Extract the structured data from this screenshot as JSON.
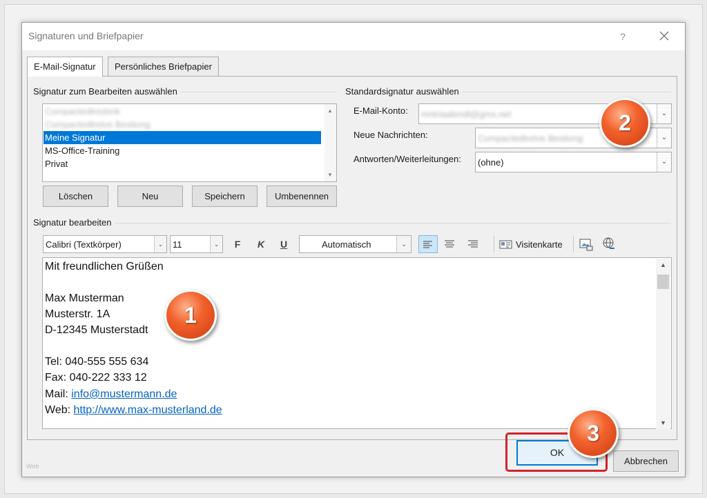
{
  "dialog": {
    "title": "Signaturen und Briefpapier",
    "help_label": "?"
  },
  "tabs": [
    {
      "label": "E-Mail-Signatur",
      "active": true
    },
    {
      "label": "Persönliches Briefpapier",
      "active": false
    }
  ],
  "signature_select": {
    "group_label": "Signatur zum Bearbeiten auswählen",
    "items": [
      {
        "label": "Compactedtredsrik",
        "blurred": true,
        "selected": false
      },
      {
        "label": "Compactedtrelve Bestiong",
        "blurred": true,
        "selected": false
      },
      {
        "label": "Meine Signatur",
        "blurred": false,
        "selected": true
      },
      {
        "label": "MS-Office-Training",
        "blurred": false,
        "selected": false
      },
      {
        "label": "Privat",
        "blurred": false,
        "selected": false
      }
    ],
    "buttons": {
      "delete": "Löschen",
      "new": "Neu",
      "save": "Speichern",
      "rename": "Umbenennen"
    }
  },
  "default_signature": {
    "group_label": "Standardsignatur auswählen",
    "email_account_label": "E-Mail-Konto:",
    "email_account_value": "mntriaalendl@gmx.net",
    "new_messages_label": "Neue Nachrichten:",
    "new_messages_value": "Compactedtrelve Bestiong",
    "replies_label": "Antworten/Weiterleitungen:",
    "replies_value": "(ohne)"
  },
  "editor": {
    "group_label": "Signatur bearbeiten",
    "font_name": "Calibri (Textkörper)",
    "font_size": "11",
    "bold_label": "F",
    "italic_label": "K",
    "underline_label": "U",
    "color_value": "Automatisch",
    "business_card_label": "Visitenkarte",
    "lines": {
      "greeting": "Mit freundlichen Grüßen",
      "name": "Max Musterman",
      "street": "Musterstr. 1A",
      "city": "D-12345 Musterstadt",
      "tel": "Tel: 040-555 555 634",
      "fax": "Fax: 040-222 333 12",
      "mail_prefix": "Mail: ",
      "mail_link": "info@mustermann.de",
      "web_prefix": "Web: ",
      "web_link": "http://www.max-musterland.de"
    }
  },
  "footer": {
    "ok_label": "OK",
    "cancel_label": "Abbrechen",
    "watermark": "Web"
  },
  "callouts": {
    "one": "1",
    "two": "2",
    "three": "3"
  },
  "colors": {
    "selection": "#0078d7",
    "link": "#0563c1",
    "highlight_border": "#d0212d",
    "callout": "#f2622d"
  },
  "icons": {
    "close": "close-icon",
    "business_card": "business-card-icon",
    "picture": "insert-picture-icon",
    "hyperlink": "hyperlink-icon"
  }
}
